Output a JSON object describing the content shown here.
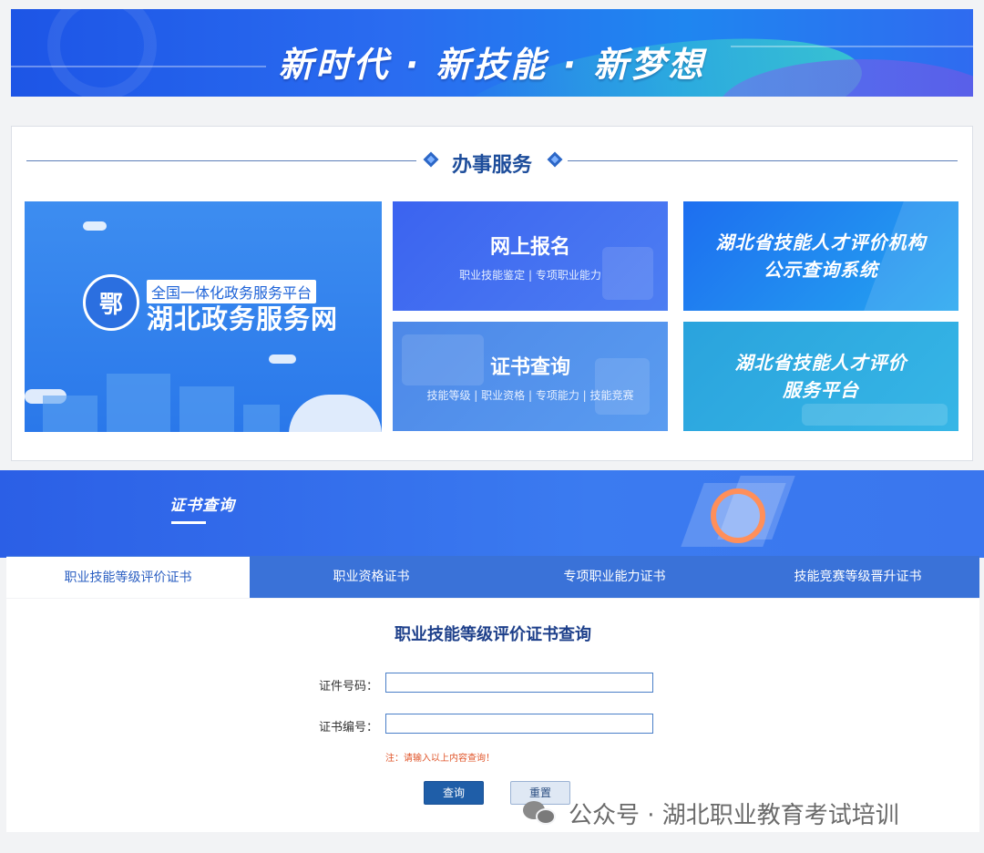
{
  "banner": {
    "title": "新时代 · 新技能 · 新梦想"
  },
  "services": {
    "title": "办事服务",
    "gov_card": {
      "emblem": "鄂",
      "platform": "全国一体化政务服务平台",
      "name": "湖北政务服务网"
    },
    "signup_card": {
      "title": "网上报名",
      "subtitle": "职业技能鉴定 | 专项职业能力"
    },
    "cert_card": {
      "title": "证书查询",
      "subtitle": "技能等级 | 职业资格 | 专项能力 | 技能竞赛"
    },
    "org_card": {
      "line1": "湖北省技能人才评价机构",
      "line2": "公示查询系统"
    },
    "platform_card": {
      "line1": "湖北省技能人才评价",
      "line2": "服务平台"
    }
  },
  "query": {
    "banner_title": "证书查询",
    "tabs": [
      "职业技能等级评价证书",
      "职业资格证书",
      "专项职业能力证书",
      "技能竞赛等级晋升证书"
    ],
    "form_title": "职业技能等级评价证书查询",
    "id_label": "证件号码：",
    "id_value": "",
    "cert_label": "证书编号：",
    "cert_value": "",
    "note": "注：请输入以上内容查询！",
    "submit_label": "查询",
    "reset_label": "重置"
  },
  "watermark": {
    "text": "公众号 · 湖北职业教育考试培训"
  }
}
